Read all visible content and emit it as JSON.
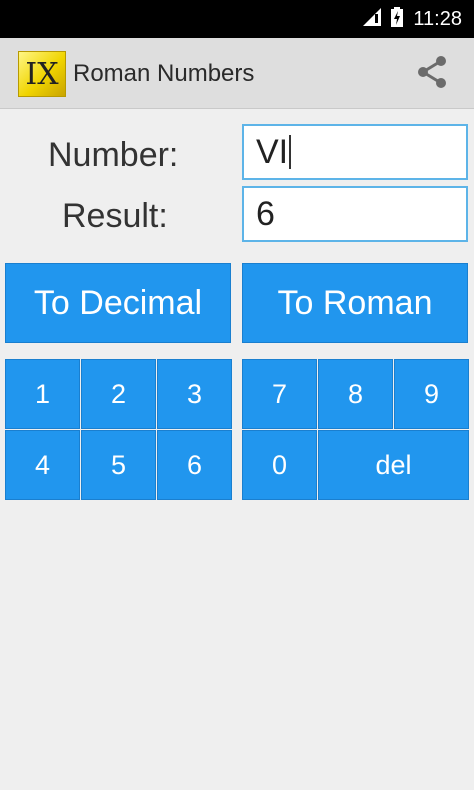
{
  "status_bar": {
    "time": "11:28"
  },
  "app": {
    "logo_text": "IX",
    "title": "Roman Numbers"
  },
  "form": {
    "number_label": "Number:",
    "number_value": "VI",
    "result_label": "Result:",
    "result_value": "6"
  },
  "actions": {
    "to_decimal": "To Decimal",
    "to_roman": "To Roman"
  },
  "keypad": {
    "left": [
      "1",
      "2",
      "3",
      "4",
      "5",
      "6"
    ],
    "right": [
      "7",
      "8",
      "9",
      "0",
      "del"
    ]
  },
  "colors": {
    "button": "#2196ee",
    "field_border": "#5db4e8",
    "action_bar": "#dedede"
  }
}
